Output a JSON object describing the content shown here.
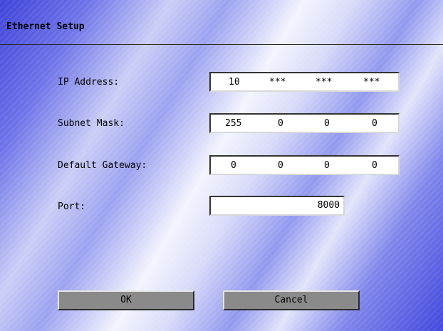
{
  "window": {
    "title": "Ethernet Setup"
  },
  "form": {
    "ip_label": "IP Address:",
    "ip": [
      "10",
      "***",
      "***",
      "***"
    ],
    "subnet_label": "Subnet Mask:",
    "subnet": [
      "255",
      "0",
      "0",
      "0"
    ],
    "gateway_label": "Default Gateway:",
    "gateway": [
      "0",
      "0",
      "0",
      "0"
    ],
    "port_label": "Port:",
    "port": "8000"
  },
  "buttons": {
    "ok": "OK",
    "cancel": "Cancel"
  }
}
